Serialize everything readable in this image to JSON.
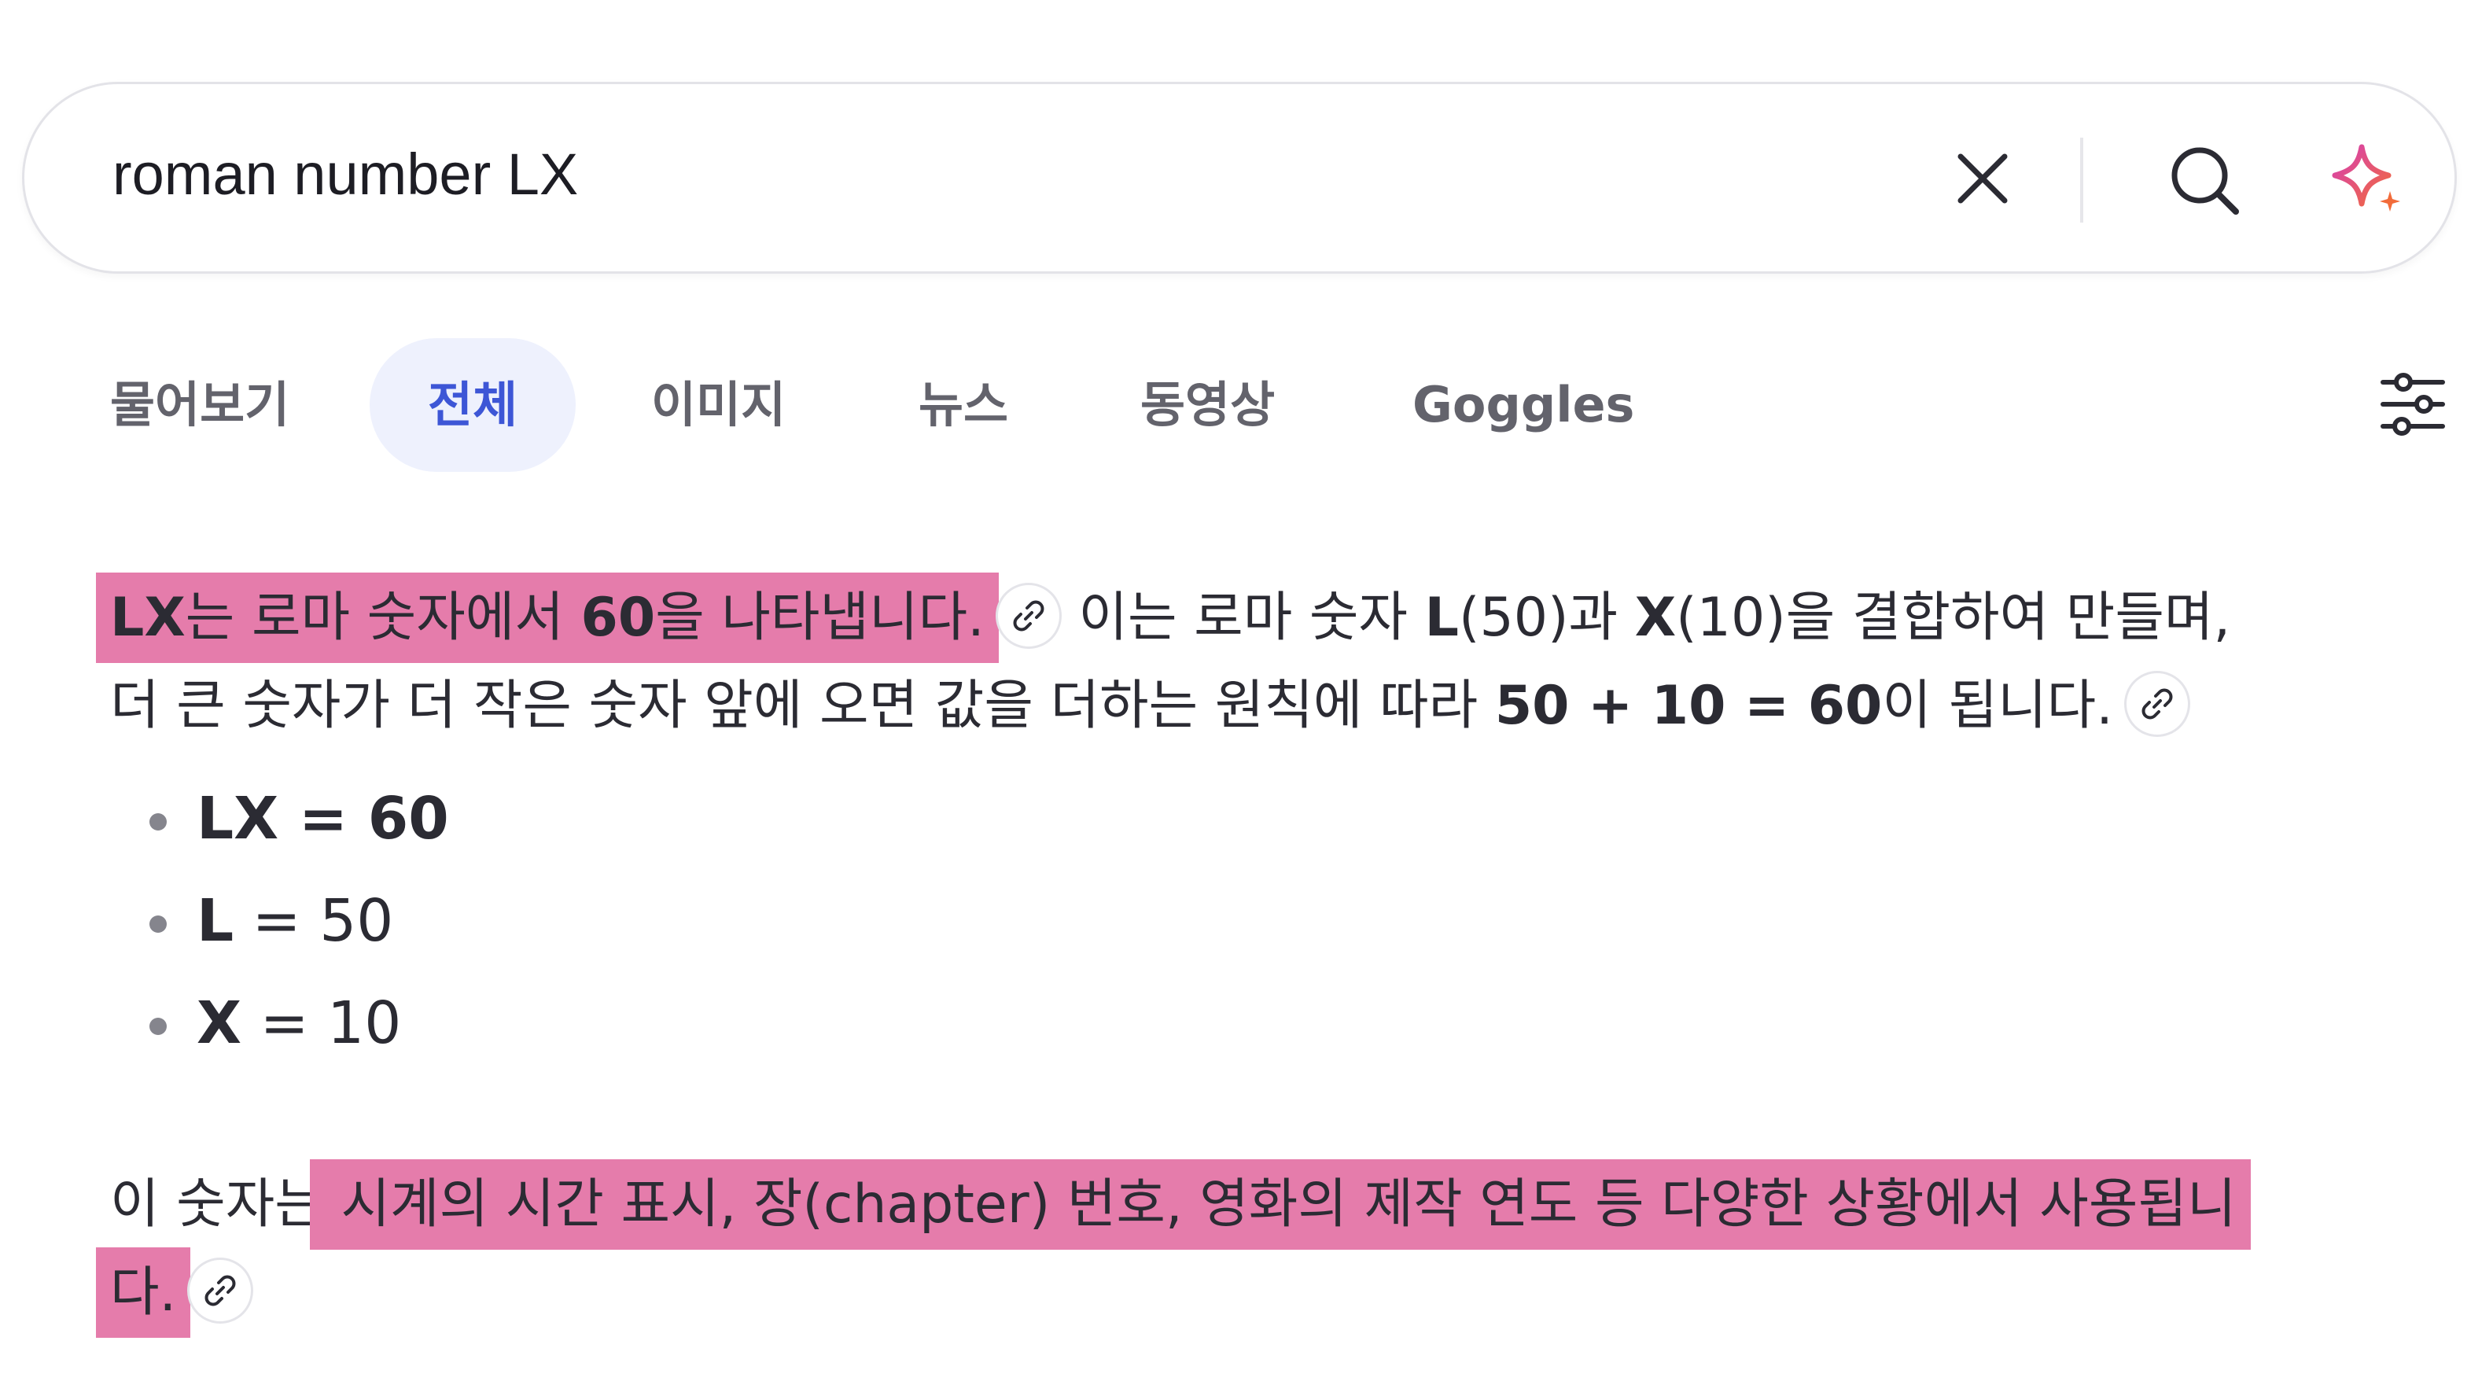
{
  "search": {
    "query": "roman number LX",
    "icons": [
      "close-icon",
      "search-icon",
      "sparkle-icon"
    ]
  },
  "tabs": [
    {
      "label": "물어보기",
      "active": false
    },
    {
      "label": "전체",
      "active": true
    },
    {
      "label": "이미지",
      "active": false
    },
    {
      "label": "뉴스",
      "active": false
    },
    {
      "label": "동영상",
      "active": false
    },
    {
      "label": "Goggles",
      "active": false
    }
  ],
  "answer": {
    "p1": {
      "hl_bold1": "LX",
      "hl_text1": "는 로마 숫자에서 ",
      "hl_bold2": "60",
      "hl_text2": "을 나타냅니다.",
      "t1": " 이는 로마 숫자 ",
      "b1": "L",
      "t2": "(50)과 ",
      "b2": "X",
      "t3": "(10)을 결합하여 만들며,",
      "t4": "더 큰 숫자가 더 작은 숫자 앞에 오면 값을 더하는 원칙에 따라 ",
      "b3": "50 + 10 = 60",
      "t5": "이 됩니다."
    },
    "bullets": [
      {
        "bold": "LX = 60",
        "rest": ""
      },
      {
        "bold": "L",
        "rest": " = 50"
      },
      {
        "bold": "X",
        "rest": " = 10"
      }
    ],
    "p2": {
      "t1": "이 숫자는",
      "hl1": " 시계의 시간 표시, 장(chapter) 번호, 영화의 제작 연도 등 다양한 상황에서 사용됩니",
      "hl2": "다."
    }
  },
  "colors": {
    "highlight": "#e57cab",
    "active_tab_bg": "#eef1fd",
    "active_tab_text": "#3d56d6",
    "sparkle_gradient": [
      "#d63fb4",
      "#f26b3a"
    ]
  }
}
